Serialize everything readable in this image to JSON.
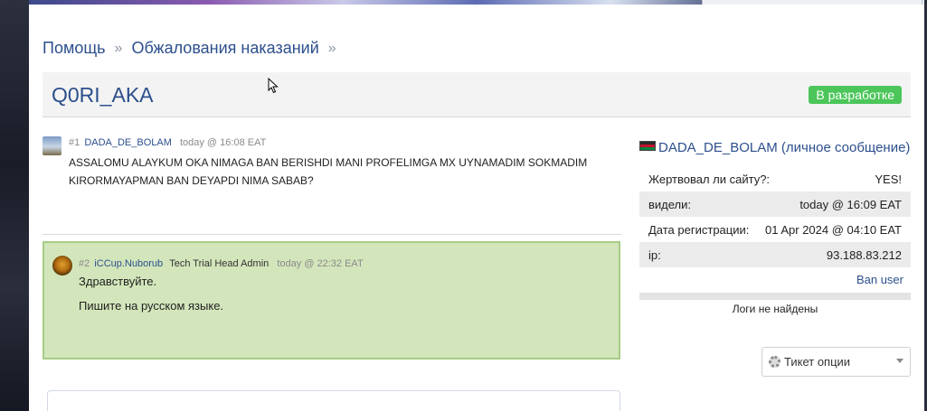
{
  "breadcrumb": {
    "items": [
      "Помощь",
      "Обжалования наказаний"
    ],
    "separator": "»"
  },
  "thread": {
    "title": "Q0RI_AKA",
    "status": "В разработке",
    "status_color": "#4cc65a"
  },
  "posts": [
    {
      "number": "#1",
      "author": "DADA_DE_BOLAM",
      "time": "today @ 16:08 EAT",
      "body": "ASSALOMU ALAYKUM OKA NIMAGA BAN BERISHDI MANI PROFELIMGA MX UYNAMADIM SOKMADIM KIRORMAYAPMAN BAN DEYAPDI NIMA SABAB?"
    },
    {
      "number": "#2",
      "author": "iCCup.Nuborub",
      "role": "Tech Trial Head Admin",
      "time": "today @ 22:32 EAT",
      "paragraphs": [
        "Здравствуйте.",
        "Пишите на русском языке."
      ]
    }
  ],
  "sidebar": {
    "username": "DADA_DE_BOLAM",
    "pm_label": "(личное сообщение)",
    "rows": [
      {
        "label": "Жертвовал ли сайту?:",
        "value": "YES!"
      },
      {
        "label": "видели:",
        "value": "today @ 16:09 EAT"
      },
      {
        "label": "Дата регистрации:",
        "value": "01 Apr 2024 @ 04:10 EAT"
      },
      {
        "label": "ip:",
        "value": "93.188.83.212"
      }
    ],
    "ban_label": "Ban user",
    "logs_label": "Логи не найдены",
    "ticket_options_label": "Тикет опции"
  }
}
